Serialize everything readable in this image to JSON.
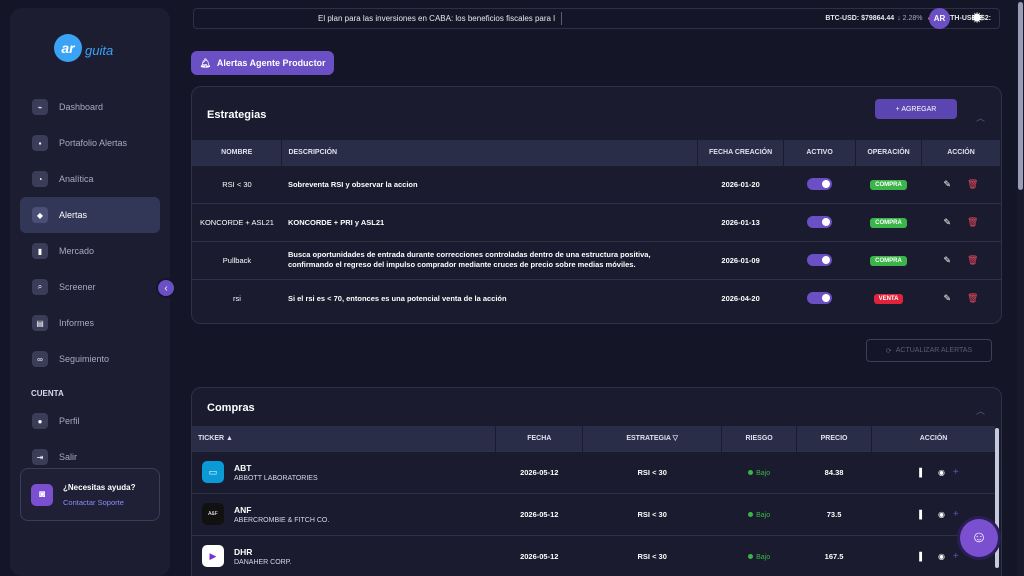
{
  "brand": {
    "logo_mark": "ar",
    "logo_text": "guita"
  },
  "nav": {
    "items": [
      {
        "label": "Dashboard",
        "icon": "chart-icon"
      },
      {
        "label": "Portafolio Alertas",
        "icon": "briefcase-icon"
      },
      {
        "label": "Analítica",
        "icon": "pie-icon"
      },
      {
        "label": "Alertas",
        "icon": "bell-icon"
      },
      {
        "label": "Mercado",
        "icon": "bars-icon"
      },
      {
        "label": "Screener",
        "icon": "search-icon"
      },
      {
        "label": "Informes",
        "icon": "file-icon"
      },
      {
        "label": "Seguimiento",
        "icon": "binoculars-icon"
      }
    ],
    "section_account": "CUENTA",
    "account_items": [
      {
        "label": "Perfil",
        "icon": "user-icon"
      },
      {
        "label": "Salir",
        "icon": "logout-icon"
      }
    ]
  },
  "help": {
    "title": "¿Necesitas ayuda?",
    "link": "Contactar Soporte"
  },
  "topbar": {
    "news": "El plan para las inversiones en CABA: los beneficios fiscales para l",
    "btc_label": "BTC-USD: $79864.44",
    "btc_change": "↓ 2.28%",
    "eth_label": "ETH-USD: $2:",
    "avatar": "AR"
  },
  "page_button": "Alertas Agente Productor",
  "strategies": {
    "title": "Estrategias",
    "add_label": "+ AGREGAR",
    "headers": [
      "NOMBRE",
      "DESCRIPCIÓN",
      "FECHA CREACIÓN",
      "ACTIVO",
      "OPERACIÓN",
      "ACCIÓN"
    ],
    "rows": [
      {
        "name": "RSI < 30",
        "desc": "Sobreventa RSI y observar la accion",
        "date": "2026-01-20",
        "op": "COMPRA",
        "op_color": "green"
      },
      {
        "name": "KONCORDE + ASL21",
        "desc": "KONCORDE + PRI y ASL21",
        "date": "2026-01-13",
        "op": "COMPRA",
        "op_color": "green"
      },
      {
        "name": "Pullback",
        "desc": "Busca oportunidades de entrada durante correcciones controladas dentro de una estructura positiva, confirmando el regreso del impulso comprador mediante cruces de precio sobre medias móviles.",
        "date": "2026-01-09",
        "op": "COMPRA",
        "op_color": "green"
      },
      {
        "name": "rsi",
        "desc": "Si el rsi es < 70, entonces es una potencial venta de la acción",
        "date": "2026-04-20",
        "op": "VENTA",
        "op_color": "red"
      }
    ]
  },
  "refresh_label": "ACTUALIZAR ALERTAS",
  "purchases": {
    "title": "Compras",
    "headers": [
      "TICKER ▲",
      "FECHA",
      "ESTRATEGIA ▽",
      "RIESGO",
      "PRECIO",
      "ACCIÓN"
    ],
    "rows": [
      {
        "symbol": "ABT",
        "company": "ABBOTT LABORATORIES",
        "date": "2026-05-12",
        "strategy": "RSI < 30",
        "risk": "Bajo",
        "price": "84.38",
        "logo_color": "#0a9bd6"
      },
      {
        "symbol": "ANF",
        "company": "ABERCROMBIE & FITCH CO.",
        "date": "2026-05-12",
        "strategy": "RSI < 30",
        "risk": "Bajo",
        "price": "73.5",
        "logo_color": "#111111"
      },
      {
        "symbol": "DHR",
        "company": "DANAHER CORP.",
        "date": "2026-05-12",
        "strategy": "RSI < 30",
        "risk": "Bajo",
        "price": "167.5",
        "logo_color": "#ffffff"
      }
    ]
  }
}
